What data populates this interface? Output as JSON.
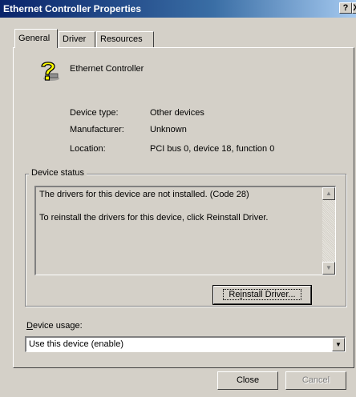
{
  "window": {
    "title": "Ethernet Controller Properties",
    "help_glyph": "?",
    "close_glyph": "X"
  },
  "tabs": [
    {
      "label": "General",
      "active": true
    },
    {
      "label": "Driver",
      "active": false
    },
    {
      "label": "Resources",
      "active": false
    }
  ],
  "device": {
    "icon": "unknown-device-question-mark-icon",
    "name": "Ethernet Controller",
    "properties": [
      {
        "label": "Device type:",
        "value": "Other devices"
      },
      {
        "label": "Manufacturer:",
        "value": "Unknown"
      },
      {
        "label": "Location:",
        "value": "PCI bus 0, device 18, function 0"
      }
    ]
  },
  "device_status": {
    "legend": "Device status",
    "lines": [
      "The drivers for this device are not installed. (Code 28)",
      "To reinstall the drivers for this device, click Reinstall Driver."
    ],
    "reinstall_button": {
      "prefix": "Re",
      "accel": "i",
      "suffix": "nstall Driver..."
    }
  },
  "device_usage": {
    "label_accel": "D",
    "label_rest": "evice usage:",
    "selected": "Use this device (enable)"
  },
  "footer": {
    "close_label": "Close",
    "cancel_label": "Cancel"
  },
  "colors": {
    "titlebar_start": "#0a246a",
    "titlebar_end": "#a6caf0",
    "face": "#d4d0c8"
  }
}
